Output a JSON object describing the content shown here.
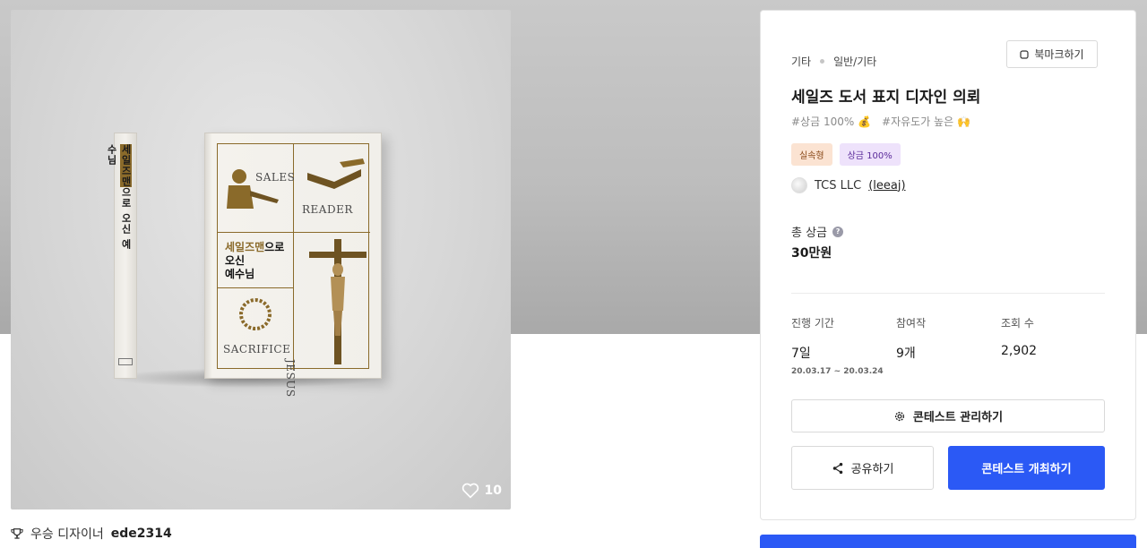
{
  "hero": {
    "book": {
      "spine_title_a": "세일즈맨",
      "spine_title_b": "으로 오신 예수님",
      "cover_title_line1_a": "세일즈맨",
      "cover_title_line1_b": "으로",
      "cover_title_line2": "오신",
      "cover_title_line3": "예수님",
      "words": {
        "sales": "SALES",
        "reader": "READER",
        "sacrifice": "SACRIFICE",
        "jesus": "JESUS"
      },
      "accent_color": "#8a6a2a"
    },
    "likes": {
      "icon": "heart-icon",
      "count": "10"
    }
  },
  "winner": {
    "icon": "trophy-icon",
    "label": "우승 디자이너",
    "name": "ede2314"
  },
  "panel": {
    "breadcrumb": {
      "category": "기타",
      "subcategory": "일반/기타"
    },
    "bookmark_label": "북마크하기",
    "title": "세일즈 도서 표지 디자인 의뢰",
    "hashtags": [
      "#상금 100% 💰",
      "#자유도가 높은 🙌"
    ],
    "badges": [
      "실속형",
      "상금 100%"
    ],
    "host": {
      "name": "TCS LLC",
      "handle": "(leeaj)"
    },
    "prize": {
      "label": "총 상금",
      "value": "30만원"
    },
    "stats": {
      "period": {
        "label": "진행 기간",
        "value": "7일",
        "range_start": "20.03.17",
        "range_sep": "~",
        "range_end": "20.03.24"
      },
      "entries": {
        "label": "참여작",
        "value": "9개"
      },
      "views": {
        "label": "조회 수",
        "value": "2,902"
      }
    },
    "buttons": {
      "manage": "콘테스트 관리하기",
      "share": "공유하기",
      "host": "콘테스트 개최하기"
    },
    "colors": {
      "primary": "#2b59f5",
      "badge_orange_bg": "#fbe3d2",
      "badge_purple_bg": "#eee2fb"
    }
  }
}
